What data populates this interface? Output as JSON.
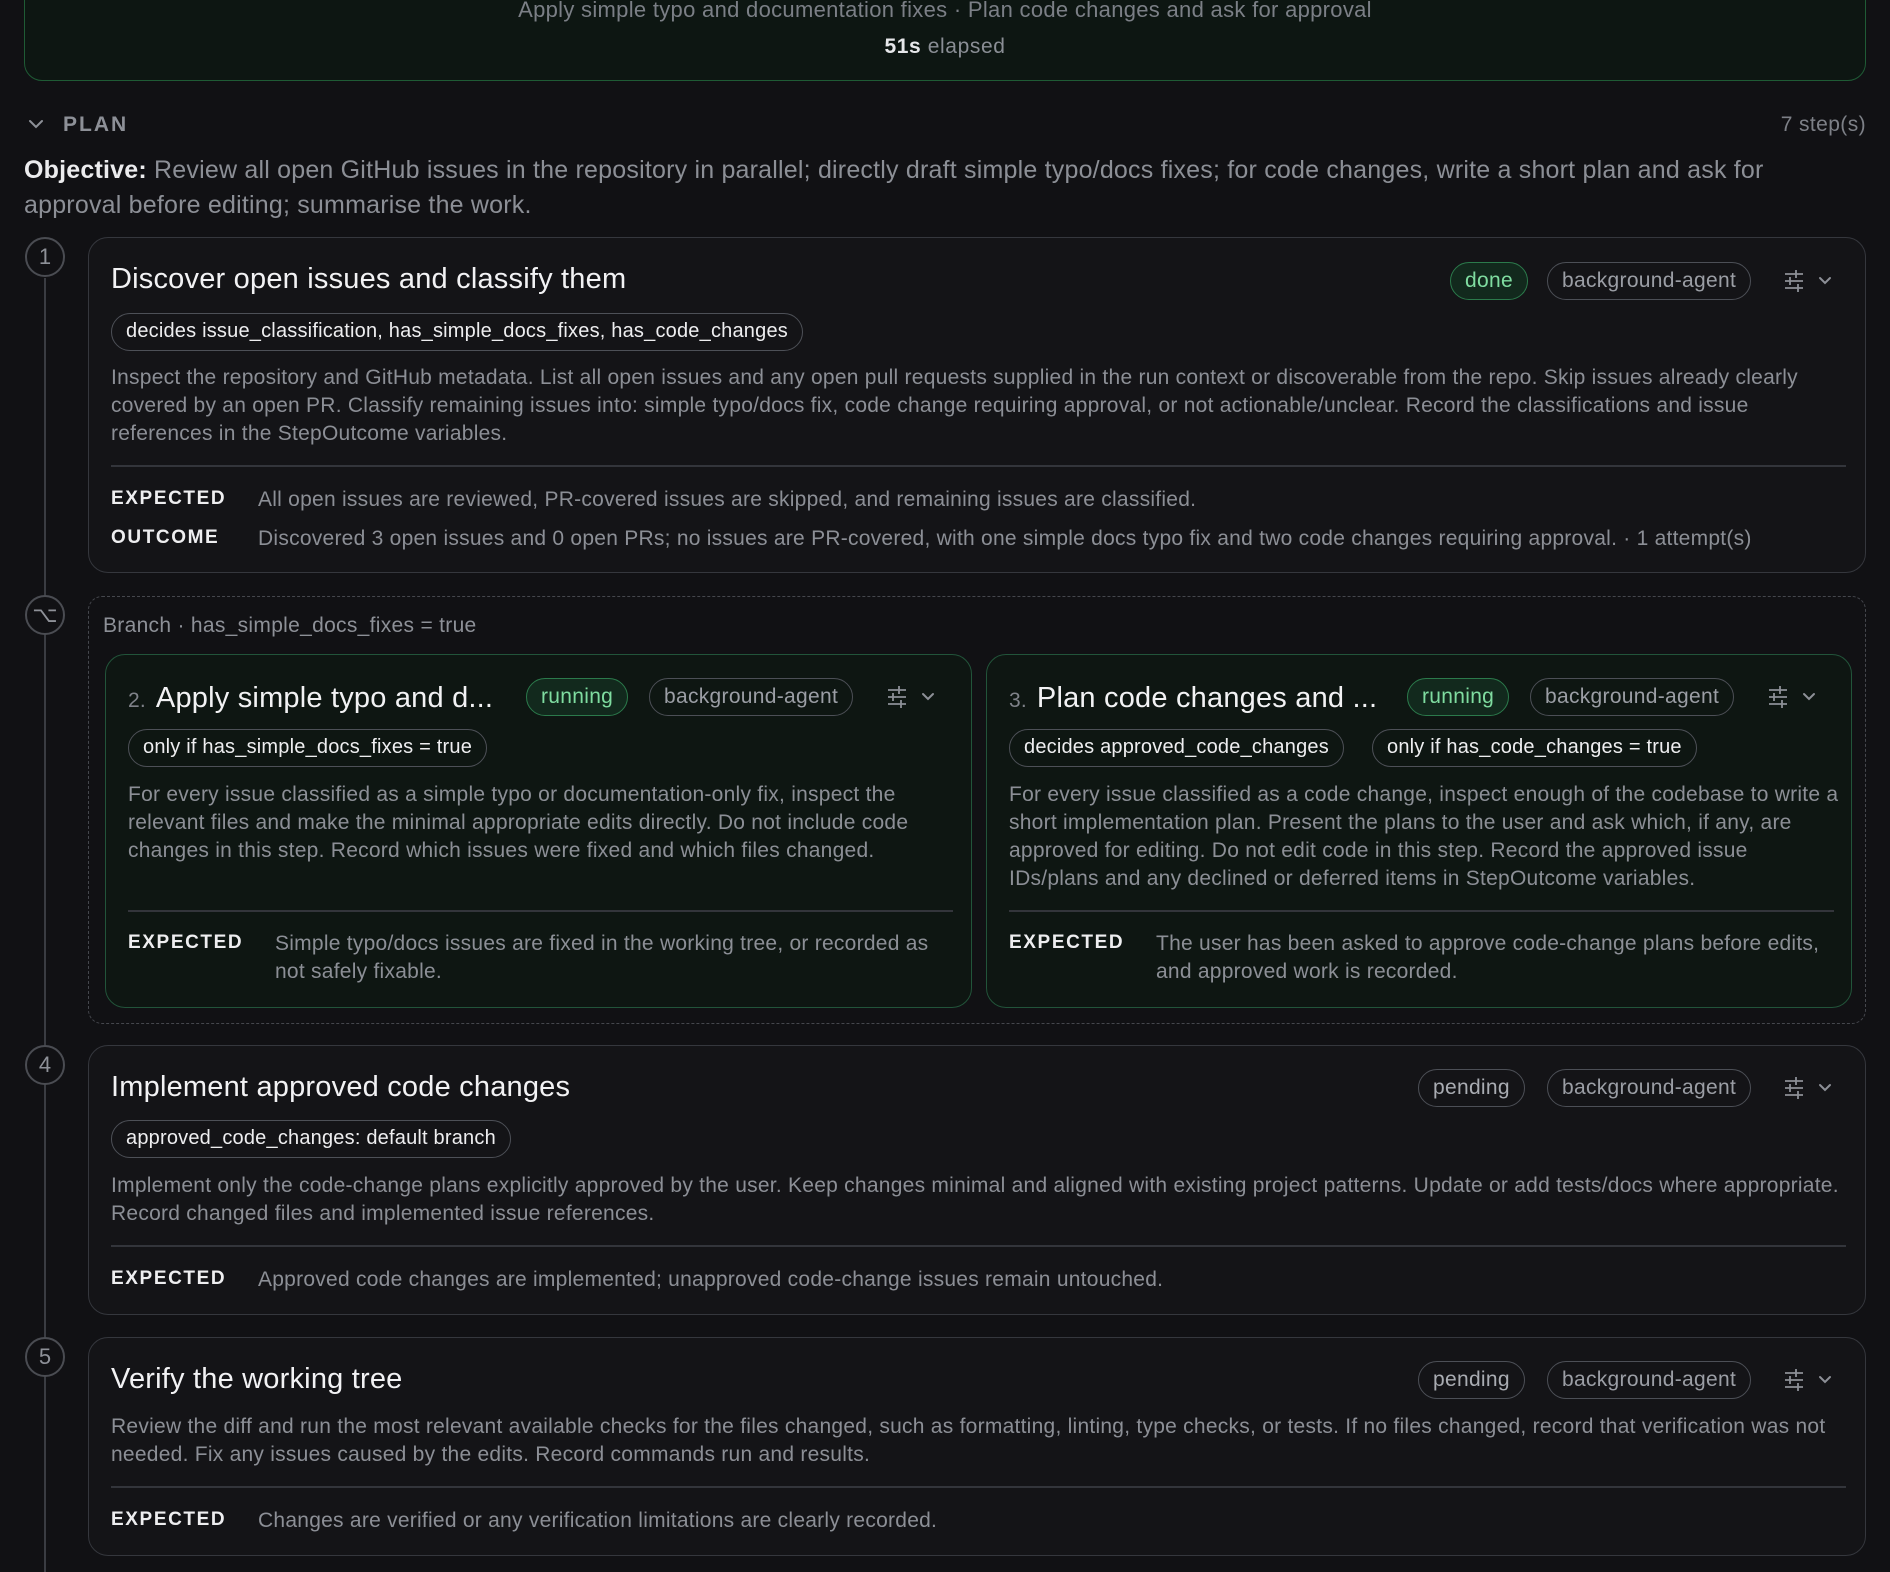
{
  "banner": {
    "subtitle": "Apply simple typo and documentation fixes · Plan code changes and ask for approval",
    "elapsed_value": "51s",
    "elapsed_label": "elapsed"
  },
  "plan": {
    "label": "PLAN",
    "step_count": "7 step(s)",
    "objective_label": "Objective:",
    "objective_text": "Review all open GitHub issues in the repository in parallel; directly draft simple typo/docs fixes; for code changes, write a short plan and ask for approval before editing; summarise the work."
  },
  "steps": [
    {
      "num": "1",
      "title": "Discover open issues and classify them",
      "status": "done",
      "agent": "background-agent",
      "pills": [
        "decides issue_classification, has_simple_docs_fixes, has_code_changes"
      ],
      "description": "Inspect the repository and GitHub metadata. List all open issues and any open pull requests supplied in the run context or discoverable from the repo. Skip issues already clearly covered by an open PR. Classify remaining issues into: simple typo/docs fix, code change requiring approval, or not actionable/unclear. Record the classifications and issue references in the StepOutcome variables.",
      "expected_label": "EXPECTED",
      "expected": "All open issues are reviewed, PR-covered issues are skipped, and remaining issues are classified.",
      "outcome_label": "OUTCOME",
      "outcome": "Discovered 3 open issues and 0 open PRs; no issues are PR-covered, with one simple docs typo fix and two code changes requiring approval. · 1 attempt(s)"
    },
    {
      "num": "⌥",
      "branch_label": "Branch · has_simple_docs_fixes = true",
      "cards": [
        {
          "idx": "2.",
          "title": "Apply simple typo and d...",
          "status": "running",
          "agent": "background-agent",
          "pills": [
            "only if has_simple_docs_fixes = true"
          ],
          "description": "For every issue classified as a simple typo or documentation-only fix, inspect the relevant files and make the minimal appropriate edits directly. Do not include code changes in this step. Record which issues were fixed and which files changed.",
          "expected_label": "EXPECTED",
          "expected": "Simple typo/docs issues are fixed in the working tree, or recorded as not safely fixable."
        },
        {
          "idx": "3.",
          "title": "Plan code changes and ...",
          "status": "running",
          "agent": "background-agent",
          "pills": [
            "decides approved_code_changes",
            "only if has_code_changes = true"
          ],
          "description": "For every issue classified as a code change, inspect enough of the codebase to write a short implementation plan. Present the plans to the user and ask which, if any, are approved for editing. Do not edit code in this step. Record the approved issue IDs/plans and any declined or deferred items in StepOutcome variables.",
          "expected_label": "EXPECTED",
          "expected": "The user has been asked to approve code-change plans before edits, and approved work is recorded."
        }
      ]
    },
    {
      "num": "4",
      "title": "Implement approved code changes",
      "status": "pending",
      "agent": "background-agent",
      "pills": [
        "approved_code_changes: default branch"
      ],
      "description": "Implement only the code-change plans explicitly approved by the user. Keep changes minimal and aligned with existing project patterns. Update or add tests/docs where appropriate. Record changed files and implemented issue references.",
      "expected_label": "EXPECTED",
      "expected": "Approved code changes are implemented; unapproved code-change issues remain untouched."
    },
    {
      "num": "5",
      "title": "Verify the working tree",
      "status": "pending",
      "agent": "background-agent",
      "description": "Review the diff and run the most relevant available checks for the files changed, such as formatting, linting, type checks, or tests. If no files changed, record that verification was not needed. Fix any issues caused by the edits. Record commands run and results.",
      "expected_label": "EXPECTED",
      "expected": "Changes are verified or any verification limitations are clearly recorded."
    }
  ],
  "icons": {
    "chevron": "chevron-down-icon",
    "settings": "sliders-icon",
    "branch": "branch-icon"
  },
  "colors": {
    "accent_green": "#7fdca0",
    "running_border": "#2b7a4b",
    "background": "#111114"
  }
}
